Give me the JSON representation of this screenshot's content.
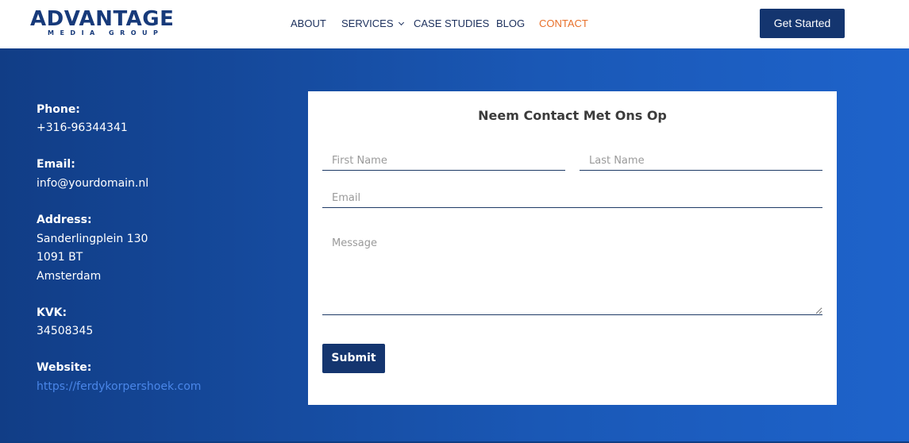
{
  "logo": {
    "main": "ADVANTAGE",
    "sub": "MEDIA GROUP"
  },
  "nav": {
    "items": [
      {
        "label": "ABOUT"
      },
      {
        "label": "SERVICES"
      },
      {
        "label": "CASE STUDIES"
      },
      {
        "label": "BLOG"
      },
      {
        "label": "CONTACT",
        "active": true
      }
    ]
  },
  "header": {
    "cta_label": "Get Started"
  },
  "contact_info": {
    "phone_label": "Phone:",
    "phone_value": "+316-96344341",
    "email_label": "Email:",
    "email_value": "info@yourdomain.nl",
    "address_label": "Address:",
    "address_lines": [
      "Sanderlingplein 130",
      "1091 BT",
      "Amsterdam"
    ],
    "kvk_label": "KVK:",
    "kvk_value": "34508345",
    "website_label": "Website:",
    "website_value": "https://ferdykorpershoek.com"
  },
  "form": {
    "title": "Neem Contact Met Ons Op",
    "first_name_placeholder": "First Name",
    "last_name_placeholder": "Last Name",
    "email_placeholder": "Email",
    "message_placeholder": "Message",
    "submit_label": "Submit"
  },
  "colors": {
    "brand_navy": "#14356f",
    "accent_orange": "#e8702a",
    "gradient_start": "#113d86",
    "gradient_end": "#1e63cb",
    "link_blue": "#4a86e8"
  },
  "icons": [
    "chevron-down-icon"
  ]
}
